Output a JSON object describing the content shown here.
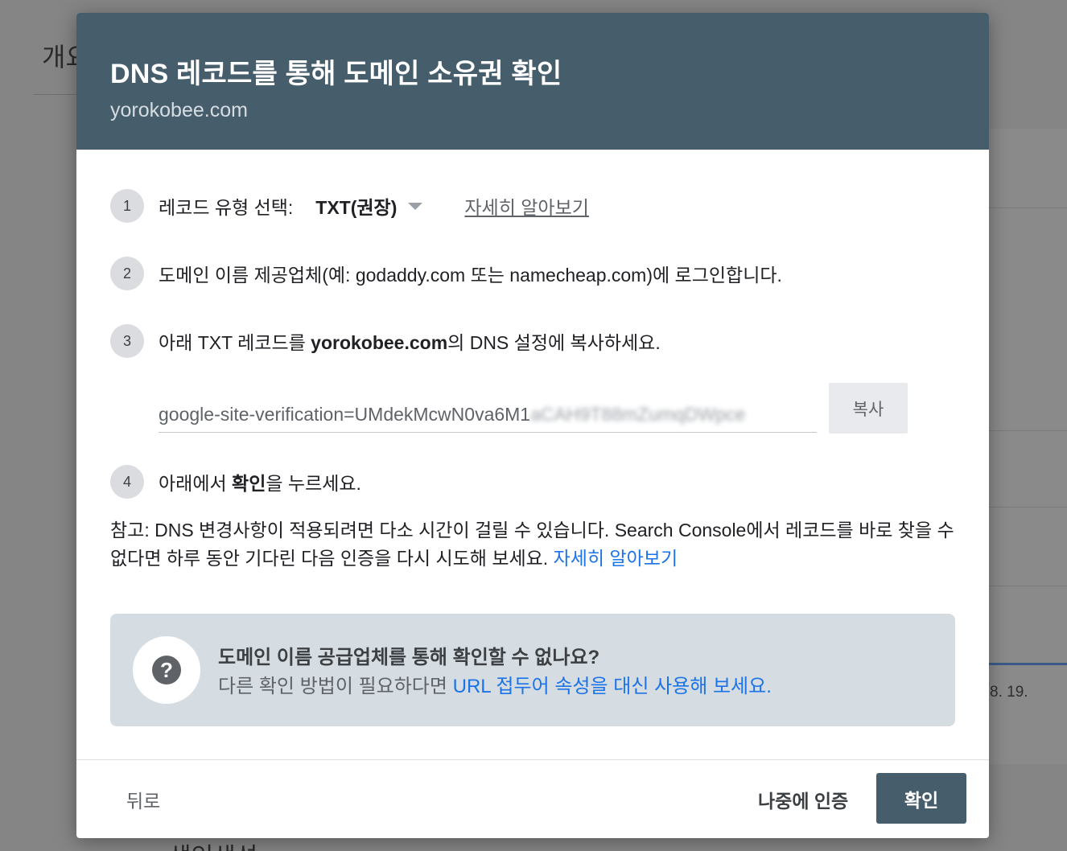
{
  "background": {
    "page_title": "개요",
    "date_fragment": "8. 19.",
    "bottom_text": "색인생성"
  },
  "dialog": {
    "title": "DNS 레코드를 통해 도메인 소유권 확인",
    "domain": "yorokobee.com",
    "steps": [
      {
        "num": "1",
        "label": "레코드 유형 선택:",
        "select_value": "TXT(권장)",
        "learn_more": "자세히 알아보기"
      },
      {
        "num": "2",
        "text": "도메인 이름 제공업체(예: godaddy.com 또는 namecheap.com)에 로그인합니다."
      },
      {
        "num": "3",
        "text_before": "아래 TXT 레코드를 ",
        "text_bold": "yorokobee.com",
        "text_after": "의 DNS 설정에 복사하세요."
      },
      {
        "num": "4",
        "text_before": "아래에서 ",
        "text_bold": "확인",
        "text_after": "을 누르세요."
      }
    ],
    "record": {
      "visible": "google-site-verification=UMdekMcwN0va6M1",
      "blurred": "aCAH9T88mZumqDWpce",
      "copy_label": "복사"
    },
    "note": {
      "text": "참고: DNS 변경사항이 적용되려면 다소 시간이 걸릴 수 있습니다. Search Console에서 레코드를 바로 찾을 수 없다면 하루 동안 기다린 다음 인증을 다시 시도해 보세요.",
      "link": "자세히 알아보기"
    },
    "help": {
      "title": "도메인 이름 공급업체를 통해 확인할 수 없나요?",
      "sub_text": "다른 확인 방법이 필요하다면 ",
      "sub_link": "URL 접두어 속성을 대신 사용해 보세요."
    },
    "footer": {
      "back": "뒤로",
      "later": "나중에 인증",
      "confirm": "확인"
    }
  },
  "colors": {
    "header": "#465d6b",
    "link": "#1a73e8",
    "help_bg": "#d6dde2"
  }
}
